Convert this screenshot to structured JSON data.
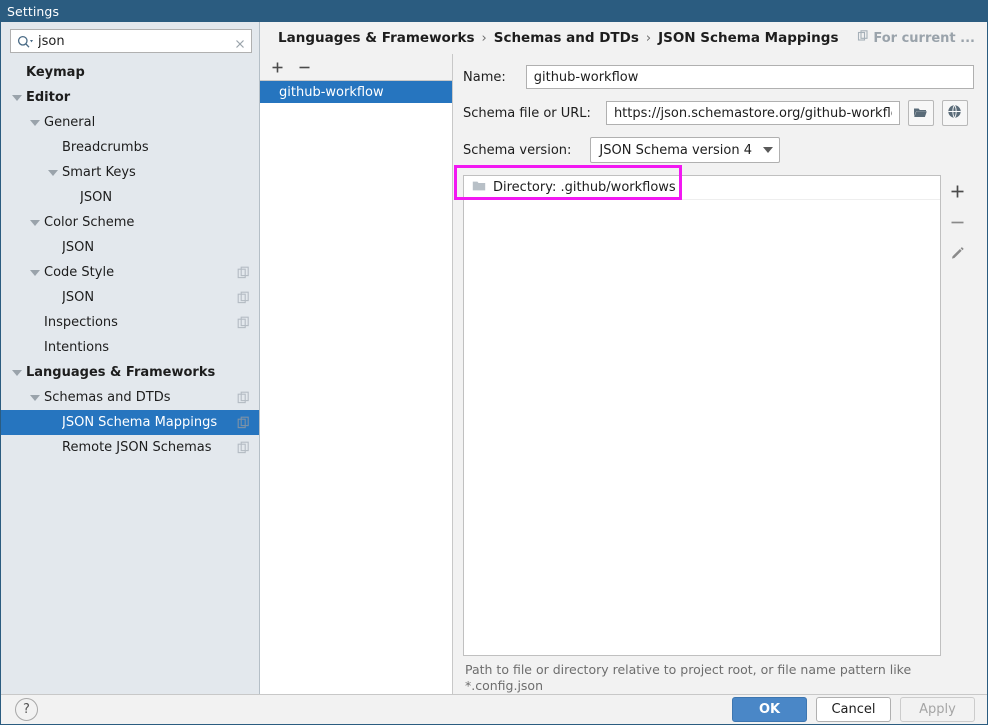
{
  "window": {
    "title": "Settings"
  },
  "sidebar": {
    "search": {
      "value": "json",
      "placeholder": ""
    },
    "tree": [
      {
        "label": "Keymap",
        "depth": 0,
        "twisty": false,
        "bold": true,
        "selected": false,
        "badge": false
      },
      {
        "label": "Editor",
        "depth": 0,
        "twisty": true,
        "bold": true,
        "selected": false,
        "badge": false
      },
      {
        "label": "General",
        "depth": 1,
        "twisty": true,
        "bold": false,
        "selected": false,
        "badge": false
      },
      {
        "label": "Breadcrumbs",
        "depth": 2,
        "twisty": false,
        "bold": false,
        "selected": false,
        "badge": false
      },
      {
        "label": "Smart Keys",
        "depth": 2,
        "twisty": true,
        "bold": false,
        "selected": false,
        "badge": false
      },
      {
        "label": "JSON",
        "depth": 3,
        "twisty": false,
        "bold": false,
        "selected": false,
        "badge": false
      },
      {
        "label": "Color Scheme",
        "depth": 1,
        "twisty": true,
        "bold": false,
        "selected": false,
        "badge": false
      },
      {
        "label": "JSON",
        "depth": 2,
        "twisty": false,
        "bold": false,
        "selected": false,
        "badge": false
      },
      {
        "label": "Code Style",
        "depth": 1,
        "twisty": true,
        "bold": false,
        "selected": false,
        "badge": true
      },
      {
        "label": "JSON",
        "depth": 2,
        "twisty": false,
        "bold": false,
        "selected": false,
        "badge": true
      },
      {
        "label": "Inspections",
        "depth": 1,
        "twisty": false,
        "bold": false,
        "selected": false,
        "badge": true
      },
      {
        "label": "Intentions",
        "depth": 1,
        "twisty": false,
        "bold": false,
        "selected": false,
        "badge": false
      },
      {
        "label": "Languages & Frameworks",
        "depth": 0,
        "twisty": true,
        "bold": true,
        "selected": false,
        "badge": false
      },
      {
        "label": "Schemas and DTDs",
        "depth": 1,
        "twisty": true,
        "bold": false,
        "selected": false,
        "badge": true
      },
      {
        "label": "JSON Schema Mappings",
        "depth": 2,
        "twisty": false,
        "bold": false,
        "selected": true,
        "badge": true
      },
      {
        "label": "Remote JSON Schemas",
        "depth": 2,
        "twisty": false,
        "bold": false,
        "selected": false,
        "badge": true
      }
    ]
  },
  "breadcrumb": {
    "items": [
      "Languages & Frameworks",
      "Schemas and DTDs",
      "JSON Schema Mappings"
    ],
    "separator": "›",
    "scope_label": "For current ..."
  },
  "list_panel": {
    "add_label": "+",
    "remove_label": "−",
    "items": [
      {
        "label": "github-workflow",
        "selected": true
      }
    ]
  },
  "form": {
    "name_label": "Name:",
    "name_value": "github-workflow",
    "schema_file_label": "Schema file or URL:",
    "schema_file_value": "https://json.schemastore.org/github-workflo",
    "schema_version_label": "Schema version:",
    "schema_version_value": "JSON Schema version 4"
  },
  "mappings": {
    "rows": [
      {
        "label": "Directory: .github/workflows",
        "icon": "folder-icon",
        "highlighted": true
      }
    ],
    "add_label": "+",
    "remove_label": "−",
    "hint": "Path to file or directory relative to project root, or file name pattern like *.config.json"
  },
  "footer": {
    "help_label": "?",
    "ok_label": "OK",
    "cancel_label": "Cancel",
    "apply_label": "Apply"
  },
  "colors": {
    "titlebar": "#2b5c80",
    "selection": "#2675bf",
    "sidebar_bg": "#e3e8ed",
    "highlight": "#f218f2",
    "primary_button": "#4a87c7"
  }
}
